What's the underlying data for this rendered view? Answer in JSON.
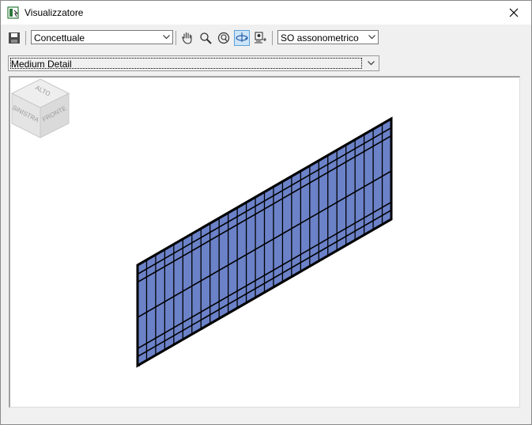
{
  "window": {
    "title": "Visualizzatore"
  },
  "toolbar": {
    "visual_style": "Concettuale",
    "view": "SO assonometrico",
    "icons": [
      "save-icon",
      "pan-hand-icon",
      "zoom-icon",
      "zoom-fit-icon",
      "orbit-icon",
      "camera-icon"
    ]
  },
  "detail_level": "Medium Detail",
  "viewcube": {
    "top": "ALTO",
    "left": "SINISTRA",
    "front": "FRONTE"
  },
  "colors": {
    "glass": "#6b82c8",
    "frame": "#000000",
    "accent": "#cce4f7"
  }
}
